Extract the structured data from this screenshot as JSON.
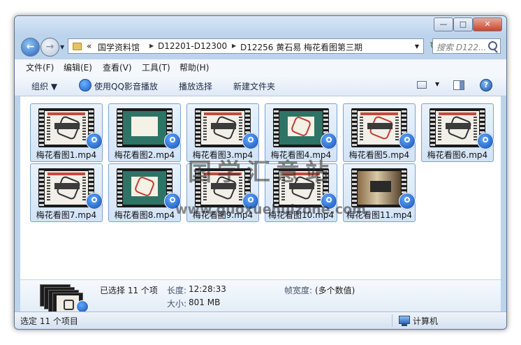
{
  "window": {
    "controls": {
      "minimize": "—",
      "maximize": "□",
      "close": "✕"
    }
  },
  "nav": {
    "back_icon": "arrow-left-icon",
    "forward_icon": "arrow-right-icon",
    "overflow": "«",
    "breadcrumb": [
      "国学资料馆",
      "D12201-D12300",
      "D12256 黄石易 梅花看图第三期"
    ],
    "search_placeholder": "搜索 D122..."
  },
  "menubar": {
    "items": [
      "文件(F)",
      "编辑(E)",
      "查看(V)",
      "工具(T)",
      "帮助(H)"
    ]
  },
  "toolbar": {
    "organize": "组织 ▼",
    "play_qq": "使用QQ影音播放",
    "play_selected": "播放选择",
    "new_folder": "新建文件夹",
    "help": "?"
  },
  "files": [
    {
      "name": "梅花看图1.mp4",
      "thumb": "slide"
    },
    {
      "name": "梅花看图2.mp4",
      "thumb": "teal"
    },
    {
      "name": "梅花看图3.mp4",
      "thumb": "slide"
    },
    {
      "name": "梅花看图4.mp4",
      "thumb": "teal-red"
    },
    {
      "name": "梅花看图5.mp4",
      "thumb": "slide-red"
    },
    {
      "name": "梅花看图6.mp4",
      "thumb": "slide"
    },
    {
      "name": "梅花看图7.mp4",
      "thumb": "slide"
    },
    {
      "name": "梅花看图8.mp4",
      "thumb": "teal-red"
    },
    {
      "name": "梅花看图9.mp4",
      "thumb": "slide"
    },
    {
      "name": "梅花看图10.mp4",
      "thumb": "slide"
    },
    {
      "name": "梅花看图11.mp4",
      "thumb": "photo"
    }
  ],
  "details": {
    "selected": "已选择 11 个项",
    "length_label": "长度:",
    "length_value": "12:28:33",
    "size_label": "大小:",
    "size_value": "801 MB",
    "framewidth_label": "帧宽度:",
    "framewidth_value": "(多个数值)"
  },
  "statusbar": {
    "left": "选定 11 个项目",
    "right": "计算机"
  },
  "watermark": {
    "cn": "国学汇意站",
    "url": "www.guoxuehuizone.com"
  },
  "colors": {
    "accent": "#2a63b8",
    "selection": "#d2e3f6",
    "selection_border": "#7da2ce"
  }
}
